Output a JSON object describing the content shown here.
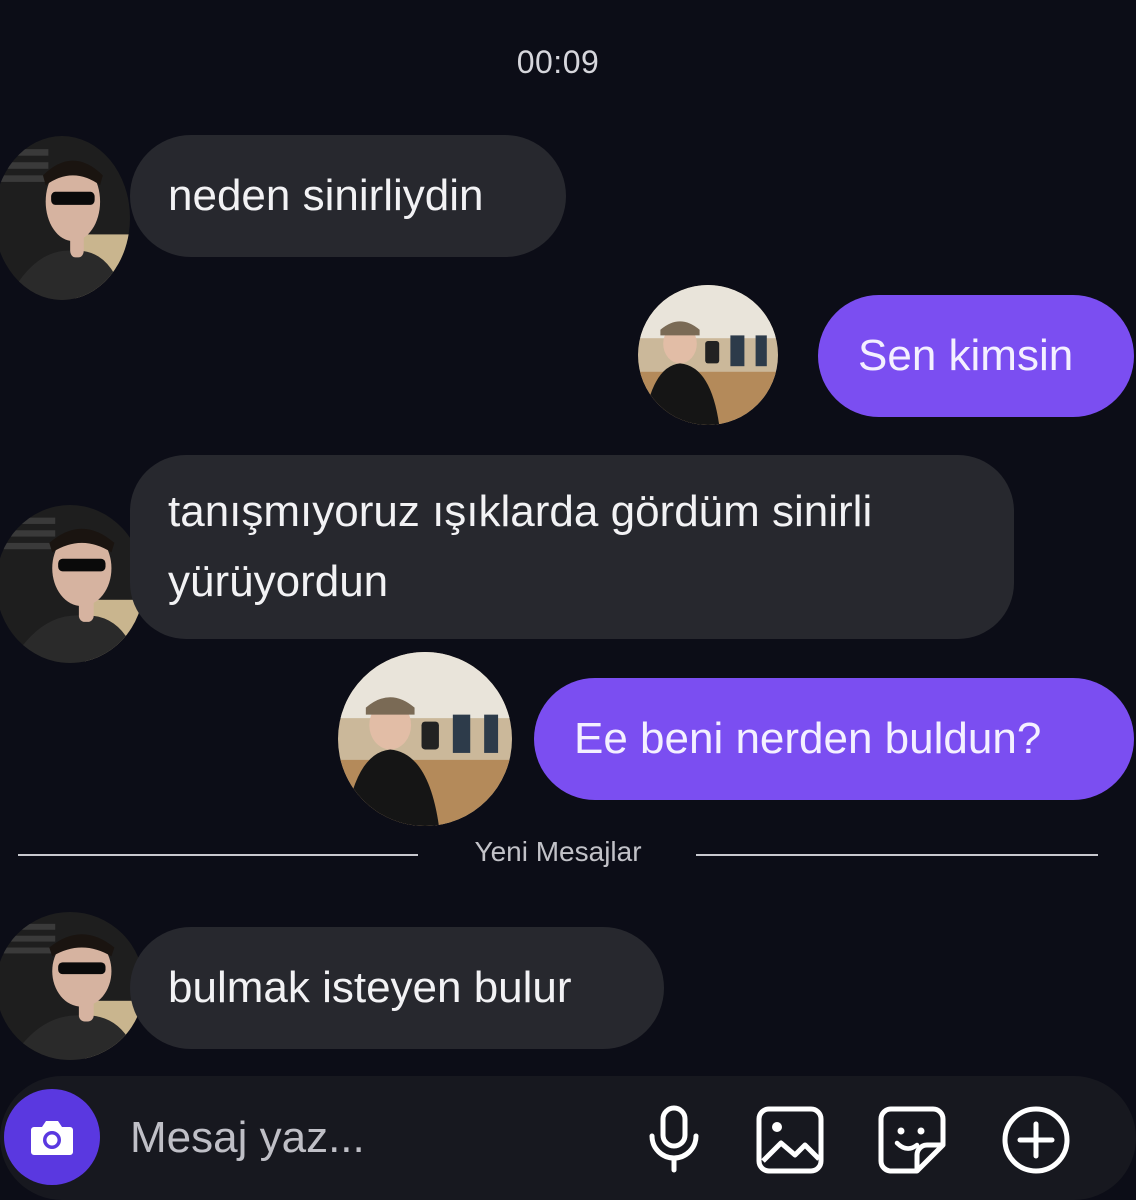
{
  "chat": {
    "timestamp": "00:09",
    "messages": [
      {
        "sender": "them",
        "text": "neden sinirliydin"
      },
      {
        "sender": "me",
        "text": "Sen kimsin"
      },
      {
        "sender": "them",
        "text": "tanışmıyoruz ışıklarda gördüm sinirli yürüyordun"
      },
      {
        "sender": "me",
        "text": "Ee beni nerden buldun?"
      },
      {
        "sender": "them",
        "text": "bulmak isteyen bulur"
      }
    ],
    "divider_label": "Yeni Mesajlar"
  },
  "composer": {
    "placeholder": "Mesaj yaz...",
    "icons": [
      "camera-icon",
      "microphone-icon",
      "image-icon",
      "sticker-icon",
      "plus-icon"
    ]
  },
  "colors": {
    "background": "#0c0d17",
    "incoming_bubble": "#27282e",
    "outgoing_bubble": "#7b4ef1",
    "camera_button": "#5a38e0"
  }
}
